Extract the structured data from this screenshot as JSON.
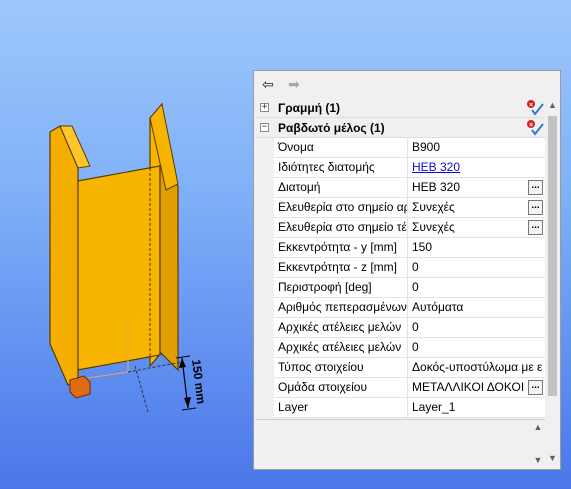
{
  "colors": {
    "beam_fill": "#f7b500",
    "beam_stroke": "#5a3c00",
    "anchor": "#e06c10",
    "background_top": "#9ec7fb",
    "background_bottom": "#4a77e8"
  },
  "viewport": {
    "dimension_label": "150 mm"
  },
  "nav": {
    "back_icon": "arrow-left-icon",
    "forward_icon": "arrow-right-icon"
  },
  "categories": [
    {
      "label": "Γραμμή (1)",
      "expander": "+"
    },
    {
      "label": "Ραβδωτό μέλος (1)",
      "expander": "−"
    }
  ],
  "properties": [
    {
      "key": "Όνομα",
      "value": "B900"
    },
    {
      "key": "Ιδιότητες διατομής",
      "value": "HEB 320"
    },
    {
      "key": "Διατομή",
      "value": "HEB 320",
      "button": "..."
    },
    {
      "key": "Ελευθερία στο σημείο αρ",
      "value": "Συνεχές",
      "button": "..."
    },
    {
      "key": "Ελευθερία στο σημείο τέ",
      "value": "Συνεχές",
      "button": "..."
    },
    {
      "key": "Εκκεντρότητα - y [mm]",
      "value": "150"
    },
    {
      "key": "Εκκεντρότητα - z [mm]",
      "value": "0"
    },
    {
      "key": "Περιστροφή [deg]",
      "value": "0"
    },
    {
      "key": "Αριθμός πεπερασμένων",
      "value": "Αυτόματα"
    },
    {
      "key": "Αρχικές ατέλειες μελών",
      "value": "0"
    },
    {
      "key": "Αρχικές ατέλειες μελών",
      "value": "0"
    },
    {
      "key": "Τύπος στοιχείου",
      "value": "Δοκός-υποστύλωμα με ε"
    },
    {
      "key": "Ομάδα στοιχείου",
      "value": "ΜΕΤΑΛΛΙΚΟΙ ΔΟΚΟΙ",
      "button": "..."
    },
    {
      "key": "Layer",
      "value": "Layer_1"
    }
  ]
}
